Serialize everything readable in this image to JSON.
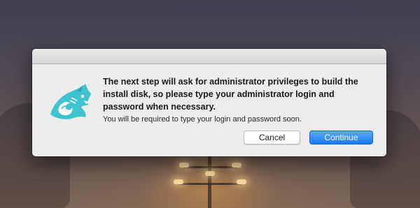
{
  "dialog": {
    "message": "The next step will ask for administrator privileges to build the install disk, so please type your administrator login and password when necessary.",
    "info": "You will be required to type your login and password soon.",
    "icon": "panther-app-icon",
    "buttons": {
      "cancel_label": "Cancel",
      "continue_label": "Continue"
    }
  },
  "colors": {
    "accent": "#1a78f5",
    "icon": "#3ec3cf"
  }
}
